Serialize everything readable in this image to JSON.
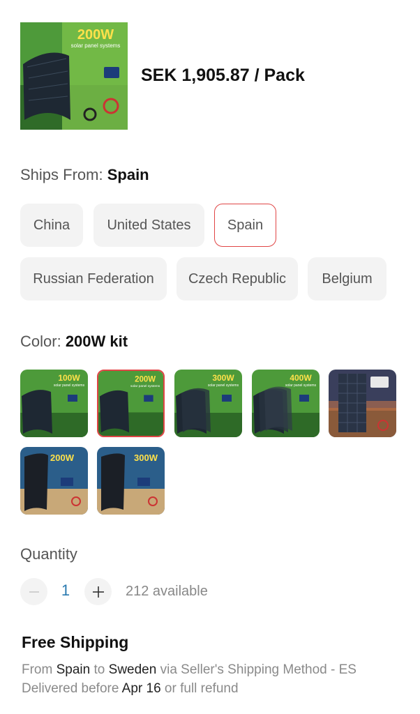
{
  "product": {
    "price": "SEK 1,905.87 / Pack",
    "thumbnail_title": "200W",
    "thumbnail_subtitle": "solar panel systems"
  },
  "ships_from": {
    "label": "Ships From:",
    "selected": "Spain",
    "options": [
      "China",
      "United States",
      "Spain",
      "Russian Federation",
      "Czech Republic",
      "Belgium"
    ]
  },
  "color": {
    "label": "Color:",
    "selected": "200W kit",
    "swatches": [
      {
        "label": "100W",
        "sub": "solar panel systems"
      },
      {
        "label": "200W",
        "sub": "solar panel systems"
      },
      {
        "label": "300W",
        "sub": "solar panel systems"
      },
      {
        "label": "400W",
        "sub": "solar panel systems"
      },
      {
        "label": "",
        "sub": ""
      },
      {
        "label": "200W",
        "sub": ""
      },
      {
        "label": "300W",
        "sub": ""
      }
    ]
  },
  "quantity": {
    "label": "Quantity",
    "value": "1",
    "available": "212 available"
  },
  "shipping": {
    "title": "Free Shipping",
    "from_prefix": "From",
    "from": "Spain",
    "to_word": "to",
    "to": "Sweden",
    "via": "via Seller's Shipping Method - ES",
    "delivered_prefix": "Delivered before",
    "date": "Apr 16",
    "suffix": "or full refund"
  },
  "colors": {
    "accent": "#e04545",
    "chip_bg": "#f3f3f3",
    "link_blue": "#2a7ab0"
  }
}
